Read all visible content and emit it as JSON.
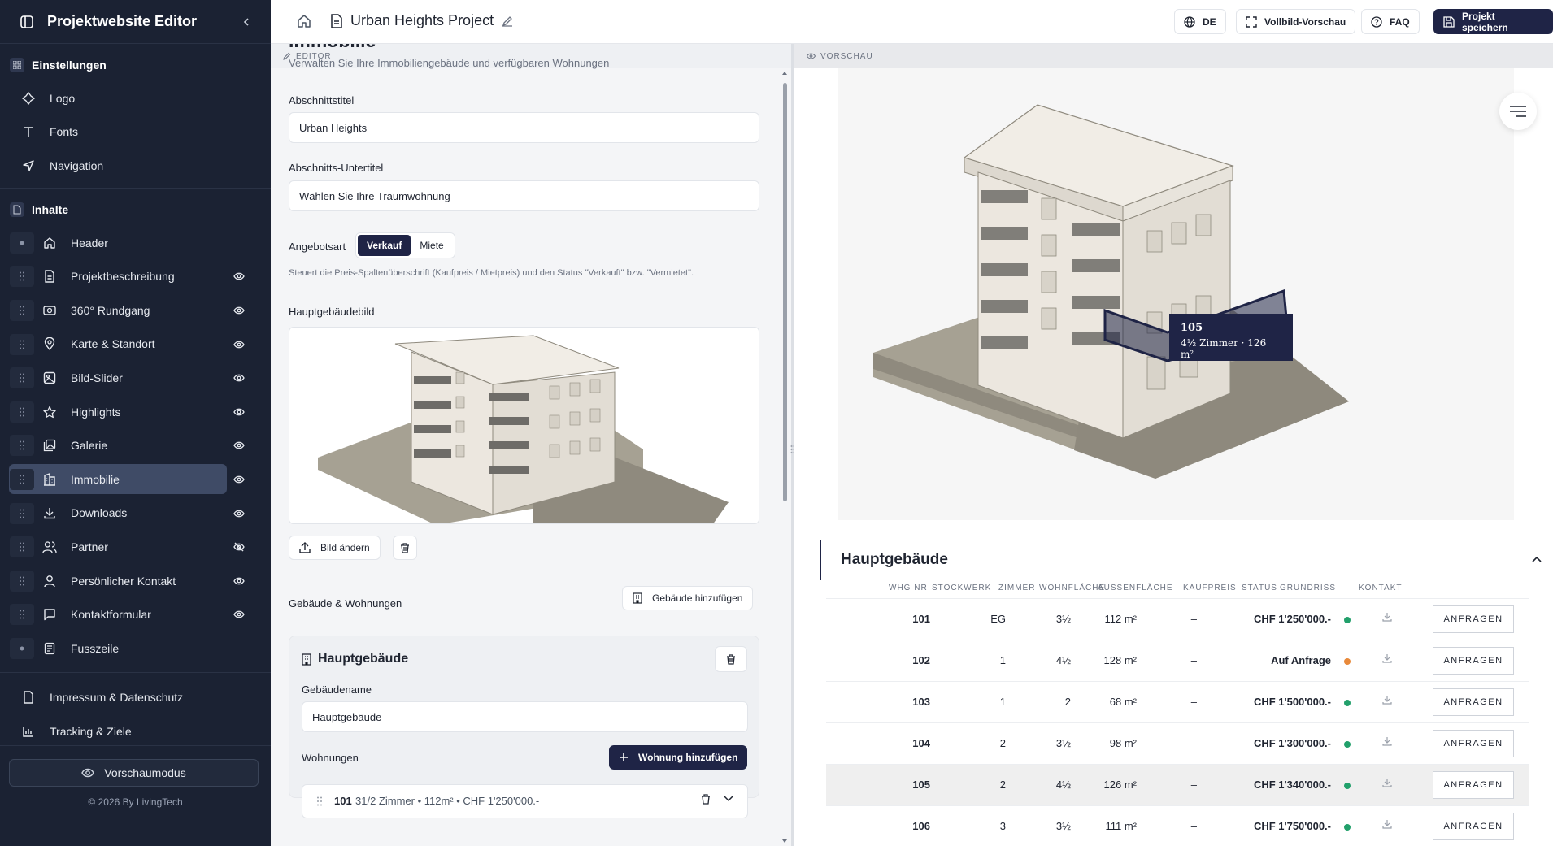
{
  "app": {
    "title": "Projektwebsite Editor",
    "copyright": "© 2026 By LivingTech",
    "preview_mode_label": "Vorschaumodus"
  },
  "sidebar": {
    "settings_section": "Einstellungen",
    "settings_items": [
      {
        "label": "Logo",
        "icon": "logo-icon"
      },
      {
        "label": "Fonts",
        "icon": "type-icon"
      },
      {
        "label": "Navigation",
        "icon": "navigation-icon"
      }
    ],
    "content_section": "Inhalte",
    "content_items": [
      {
        "label": "Header",
        "icon": "home-icon",
        "visible_toggle": false
      },
      {
        "label": "Projektbeschreibung",
        "icon": "document-icon",
        "visible_toggle": true
      },
      {
        "label": "360° Rundgang",
        "icon": "panorama-icon",
        "visible_toggle": true
      },
      {
        "label": "Karte & Standort",
        "icon": "map-pin-icon",
        "visible_toggle": true
      },
      {
        "label": "Bild-Slider",
        "icon": "image-icon",
        "visible_toggle": true
      },
      {
        "label": "Highlights",
        "icon": "star-icon",
        "visible_toggle": true
      },
      {
        "label": "Galerie",
        "icon": "gallery-icon",
        "visible_toggle": true
      },
      {
        "label": "Immobilie",
        "icon": "building-icon",
        "visible_toggle": true,
        "active": true
      },
      {
        "label": "Downloads",
        "icon": "download-icon",
        "visible_toggle": true
      },
      {
        "label": "Partner",
        "icon": "users-icon",
        "visible_toggle": true,
        "hidden": true
      },
      {
        "label": "Persönlicher Kontakt",
        "icon": "user-icon",
        "visible_toggle": true
      },
      {
        "label": "Kontaktformular",
        "icon": "message-icon",
        "visible_toggle": true
      },
      {
        "label": "Fusszeile",
        "icon": "footer-icon",
        "visible_toggle": false
      }
    ],
    "bottom_items": [
      {
        "label": "Impressum & Datenschutz",
        "icon": "document-icon"
      },
      {
        "label": "Tracking & Ziele",
        "icon": "chart-icon"
      }
    ]
  },
  "topbar": {
    "project_title": "Urban Heights Project",
    "language_label": "DE",
    "fullscreen_label": "Vollbild-Vorschau",
    "faq_label": "FAQ",
    "save_label": "Projekt speichern"
  },
  "editor": {
    "bar_label": "EDITOR",
    "heading": "Immobilie",
    "subheading": "Verwalten Sie Ihre Immobiliengebäude und verfügbaren Wohnungen",
    "section_title_label": "Abschnittstitel",
    "section_title_value": "Urban Heights",
    "section_subtitle_label": "Abschnitts-Untertitel",
    "section_subtitle_value": "Wählen Sie Ihre Traumwohnung",
    "offer_type_label": "Angebotsart",
    "offer_options": [
      "Verkauf",
      "Miete"
    ],
    "offer_selected": "Verkauf",
    "offer_hint": "Steuert die Preis-Spaltenüberschrift (Kaufpreis / Mietpreis) und den Status \"Verkauft\" bzw. \"Vermietet\".",
    "main_image_label": "Hauptgebäudebild",
    "change_image_label": "Bild ändern",
    "buildings_label": "Gebäude & Wohnungen",
    "add_building_label": "Gebäude hinzufügen",
    "building": {
      "title": "Hauptgebäude",
      "name_label": "Gebäudename",
      "name_value": "Hauptgebäude",
      "units_label": "Wohnungen",
      "add_unit_label": "Wohnung hinzufügen",
      "first_unit_no": "101",
      "first_unit_desc": "31/2 Zimmer • 112m² • CHF 1'250'000.-"
    }
  },
  "preview": {
    "bar_label": "VORSCHAU",
    "tooltip_unit": "105",
    "tooltip_desc": "4½ Zimmer · 126 m²",
    "section_title": "Hauptgebäude",
    "columns": [
      "WHG NR",
      "STOCKWERK",
      "ZIMMER",
      "WOHNFLÄCHE",
      "AUSSENFLÄCHE",
      "KAUFPREIS",
      "STATUS",
      "GRUNDRISS",
      "KONTAKT"
    ],
    "request_label": "ANFRAGEN",
    "units": [
      {
        "no": "101",
        "floor": "EG",
        "rooms": "3½",
        "area": "112 m²",
        "outdoor": "–",
        "price": "CHF 1'250'000.-",
        "status_color": "#22a06b"
      },
      {
        "no": "102",
        "floor": "1",
        "rooms": "4½",
        "area": "128 m²",
        "outdoor": "–",
        "price": "Auf Anfrage",
        "status_color": "#e8893a"
      },
      {
        "no": "103",
        "floor": "1",
        "rooms": "2",
        "area": "68 m²",
        "outdoor": "–",
        "price": "CHF 1'500'000.-",
        "status_color": "#22a06b"
      },
      {
        "no": "104",
        "floor": "2",
        "rooms": "3½",
        "area": "98 m²",
        "outdoor": "–",
        "price": "CHF 1'300'000.-",
        "status_color": "#22a06b"
      },
      {
        "no": "105",
        "floor": "2",
        "rooms": "4½",
        "area": "126 m²",
        "outdoor": "–",
        "price": "CHF 1'340'000.-",
        "status_color": "#22a06b",
        "highlighted": true
      },
      {
        "no": "106",
        "floor": "3",
        "rooms": "3½",
        "area": "111 m²",
        "outdoor": "–",
        "price": "CHF 1'750'000.-",
        "status_color": "#22a06b"
      }
    ]
  },
  "colors": {
    "sidebar_bg": "#1b2233",
    "accent": "#1f2446",
    "status_available": "#22a06b",
    "status_on_request": "#e8893a"
  }
}
